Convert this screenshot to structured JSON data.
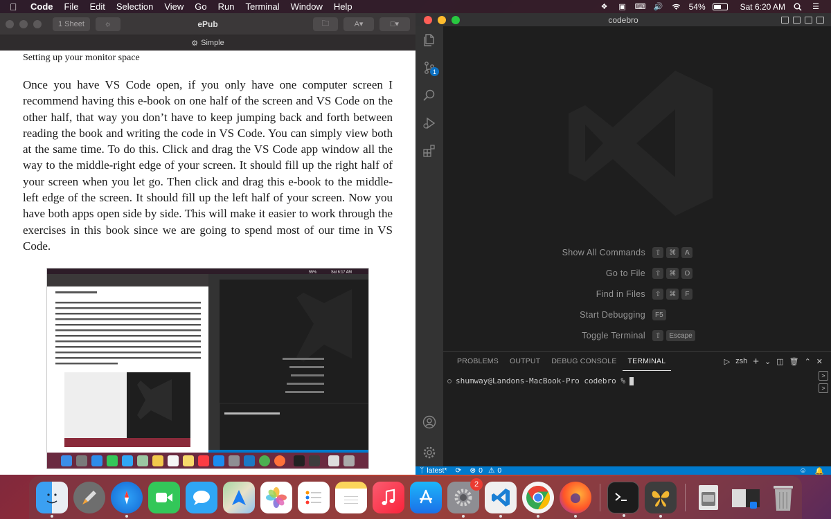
{
  "menubar": {
    "app_name": "Code",
    "menus": [
      "File",
      "Edit",
      "Selection",
      "View",
      "Go",
      "Run",
      "Terminal",
      "Window",
      "Help"
    ],
    "battery": "54%",
    "clock": "Sat 6:20 AM"
  },
  "epub": {
    "sheet_button": "1 Sheet",
    "title": "ePub",
    "theme_label": "Simple",
    "heading": "Setting up your monitor space",
    "body": "Once you have VS Code open, if you only have one computer screen I recommend having this e-book on one half of the screen and VS Code on the other half, that way you don’t have to keep jumping back and forth between reading the book and writing the code in VS Code. You can simply view both at the same time. To do this. Click and drag the VS Code app window all the way to the middle-right edge of your screen. It should fill up the right half of your screen when you let go. Then click and drag this e-book to the middle-left edge of the screen. It should fill up the left half of your screen. Now you have both apps open side by side. This will make it easier to work through the exercises in this book since we are going to spend most of our time in VS Code.",
    "figure": {
      "clock": "Sat 6:17 AM",
      "battery": "55%"
    }
  },
  "vscode": {
    "window_title": "codebro",
    "scm_badge": "1",
    "shortcuts": [
      {
        "label": "Show All Commands",
        "keys": [
          "⇧",
          "⌘",
          "A"
        ]
      },
      {
        "label": "Go to File",
        "keys": [
          "⇧",
          "⌘",
          "O"
        ]
      },
      {
        "label": "Find in Files",
        "keys": [
          "⇧",
          "⌘",
          "F"
        ]
      },
      {
        "label": "Start Debugging",
        "keys": [
          "F5"
        ]
      },
      {
        "label": "Toggle Terminal",
        "keys": [
          "⇧",
          "Escape"
        ]
      }
    ],
    "panel": {
      "tabs": [
        "PROBLEMS",
        "OUTPUT",
        "DEBUG CONSOLE",
        "TERMINAL"
      ],
      "active_tab": "TERMINAL",
      "shell": "zsh",
      "prompt": "shumway@Landons-MacBook-Pro codebro % "
    },
    "statusbar": {
      "branch": "latest*",
      "errors": "0",
      "warnings": "0"
    }
  },
  "dock": {
    "items": [
      "Finder",
      "Launchpad",
      "Safari",
      "FaceTime",
      "Messages",
      "Maps",
      "Photos",
      "Reminders",
      "Notes",
      "Music",
      "App Store",
      "System Preferences",
      "Visual Studio Code",
      "Google Chrome",
      "Firefox",
      "Terminal",
      "Tes",
      "Downloads",
      "Screenshot",
      "Trash"
    ],
    "system_prefs_badge": "2"
  },
  "colors": {
    "vscode_accent": "#007acc",
    "editor_bg": "#1e1e1e",
    "activity_bg": "#333333"
  }
}
